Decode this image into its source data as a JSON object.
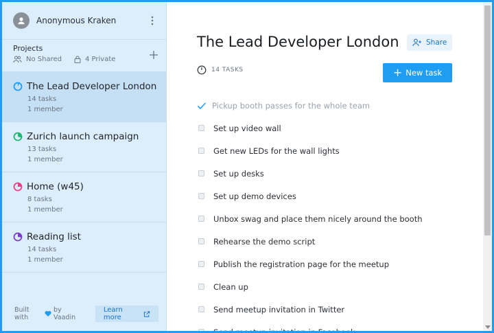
{
  "user": {
    "name": "Anonymous Kraken"
  },
  "projects_header": {
    "title": "Projects",
    "shared": "No Shared",
    "private": "4 Private"
  },
  "projects": [
    {
      "name": "The Lead Developer London",
      "tasks": "14 tasks",
      "members": "1 member",
      "color": "#1f9df2",
      "progress": 0.07,
      "active": true
    },
    {
      "name": "Zurich launch campaign",
      "tasks": "13 tasks",
      "members": "1 member",
      "color": "#22b573",
      "progress": 0.3
    },
    {
      "name": "Home (w45)",
      "tasks": "8 tasks",
      "members": "1 member",
      "color": "#e83e8c",
      "progress": 0.25
    },
    {
      "name": "Reading list",
      "tasks": "14 tasks",
      "members": "1 member",
      "color": "#7b3fc4",
      "progress": 0.28
    }
  ],
  "footer": {
    "built_prefix": "Built with",
    "built_suffix": "by Vaadin",
    "learn_more": "Learn more"
  },
  "main": {
    "title": "The Lead Developer London",
    "share_label": "Share",
    "task_count": "14 TASKS",
    "new_task_label": "New task"
  },
  "tasks": [
    {
      "label": "Pickup booth passes for the whole team",
      "done": true
    },
    {
      "label": "Set up video wall",
      "done": false
    },
    {
      "label": "Get new LEDs for the wall lights",
      "done": false
    },
    {
      "label": "Set up desks",
      "done": false
    },
    {
      "label": "Set up demo devices",
      "done": false
    },
    {
      "label": "Unbox swag and place them nicely around the booth",
      "done": false
    },
    {
      "label": "Rehearse the demo script",
      "done": false
    },
    {
      "label": "Publish the registration page for the meetup",
      "done": false
    },
    {
      "label": "Clean up",
      "done": false
    },
    {
      "label": "Send meetup invitation in Twitter",
      "done": false
    },
    {
      "label": "Send meetup invitation in Facebook",
      "done": false
    }
  ],
  "colors": {
    "accent": "#1f9df2",
    "sidebar_bg": "#dcedfb"
  }
}
